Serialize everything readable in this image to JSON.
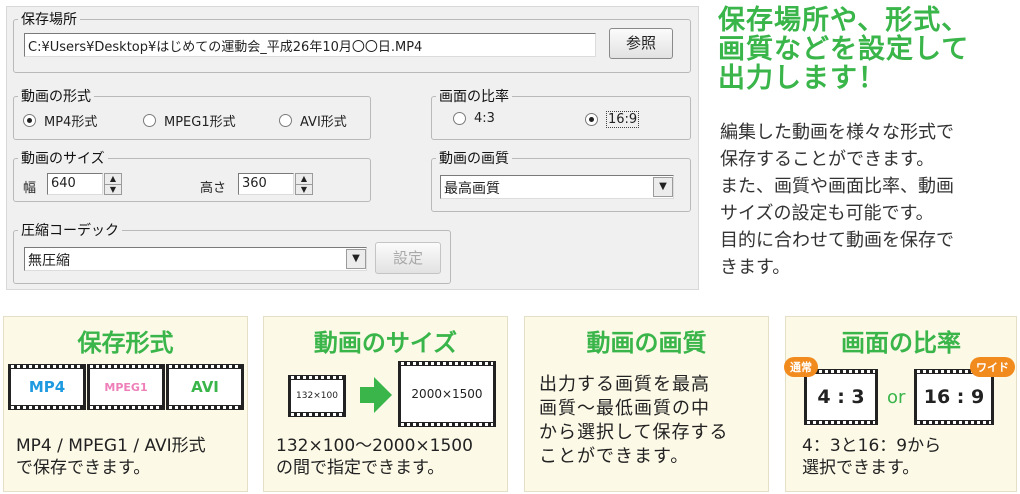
{
  "dialog": {
    "save_location": {
      "legend": "保存場所",
      "path": "C:¥Users¥Desktop¥はじめての運動会_平成26年10月〇〇日.MP4",
      "browse_button": "参照"
    },
    "format": {
      "legend": "動画の形式",
      "options": [
        "MP4形式",
        "MPEG1形式",
        "AVI形式"
      ],
      "selected": "MP4形式"
    },
    "aspect": {
      "legend": "画面の比率",
      "options": [
        "4:3",
        "16:9"
      ],
      "selected": "16:9"
    },
    "size": {
      "legend": "動画のサイズ",
      "width_label": "幅",
      "width_value": "640",
      "height_label": "高さ",
      "height_value": "360"
    },
    "quality": {
      "legend": "動画の画質",
      "value": "最高画質"
    },
    "codec": {
      "legend": "圧縮コーデック",
      "value": "無圧縮",
      "settings_button": "設定"
    }
  },
  "headline": [
    "保存場所や、形式、",
    "画質などを設定して",
    "出力します！"
  ],
  "description": [
    "編集した動画を様々な形式で",
    "保存することができます。",
    "また、画質や画面比率、動画",
    "サイズの設定も可能です。",
    "目的に合わせて動画を保存で",
    "きます。"
  ],
  "cards": {
    "format": {
      "title": "保存形式",
      "films": [
        "MP4",
        "MPEG1",
        "AVI"
      ],
      "text": [
        "MP4 / MPEG1 / AVI形式",
        "で保存できます。"
      ]
    },
    "size": {
      "title": "動画のサイズ",
      "small": "132×100",
      "large": "2000×1500",
      "text": [
        "132×100〜2000×1500",
        "の間で指定できます。"
      ]
    },
    "quality": {
      "title": "動画の画質",
      "text": [
        "出力する画質を最高",
        "画質〜最低画質の中",
        "から選択して保存する",
        "ことができます。"
      ]
    },
    "aspect": {
      "title": "画面の比率",
      "left_tag": "通常",
      "left_ratio": "4 : 3",
      "or": "or",
      "right_tag": "ワイド",
      "right_ratio": "16 : 9",
      "text": [
        "4：3と16：9から",
        "選択できます。"
      ]
    }
  },
  "colors": {
    "accent_green": "#39b54a",
    "card_bg": "#fcf9e7",
    "tag_orange": "#f28b1e",
    "mp4_blue": "#1e9be0",
    "mpeg1_pink": "#ee7fb9",
    "avi_green": "#39b54a"
  }
}
